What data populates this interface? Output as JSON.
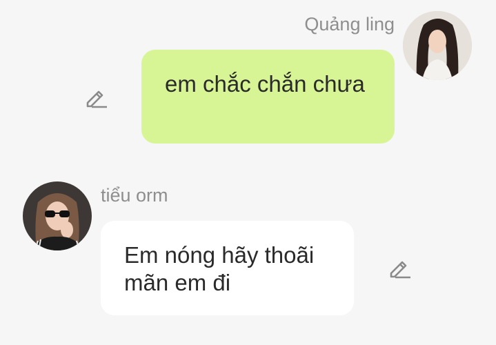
{
  "messages": [
    {
      "direction": "outgoing",
      "sender": "Quảng ling",
      "text": "em chắc chắn chưa",
      "bubble_color": "#d8f596",
      "avatar_icon": "avatar-quang-ling",
      "action_icon": "pencil-edit-icon"
    },
    {
      "direction": "incoming",
      "sender": "tiểu orm",
      "text": "Em nóng hãy thoãi mãn em đi",
      "bubble_color": "#ffffff",
      "avatar_icon": "avatar-tieu-orm",
      "action_icon": "pencil-edit-icon"
    }
  ],
  "colors": {
    "background": "#f6f6f6",
    "name_text": "#8e8e8e",
    "message_text": "#2a2a2a",
    "icon": "#8a8a8a"
  }
}
